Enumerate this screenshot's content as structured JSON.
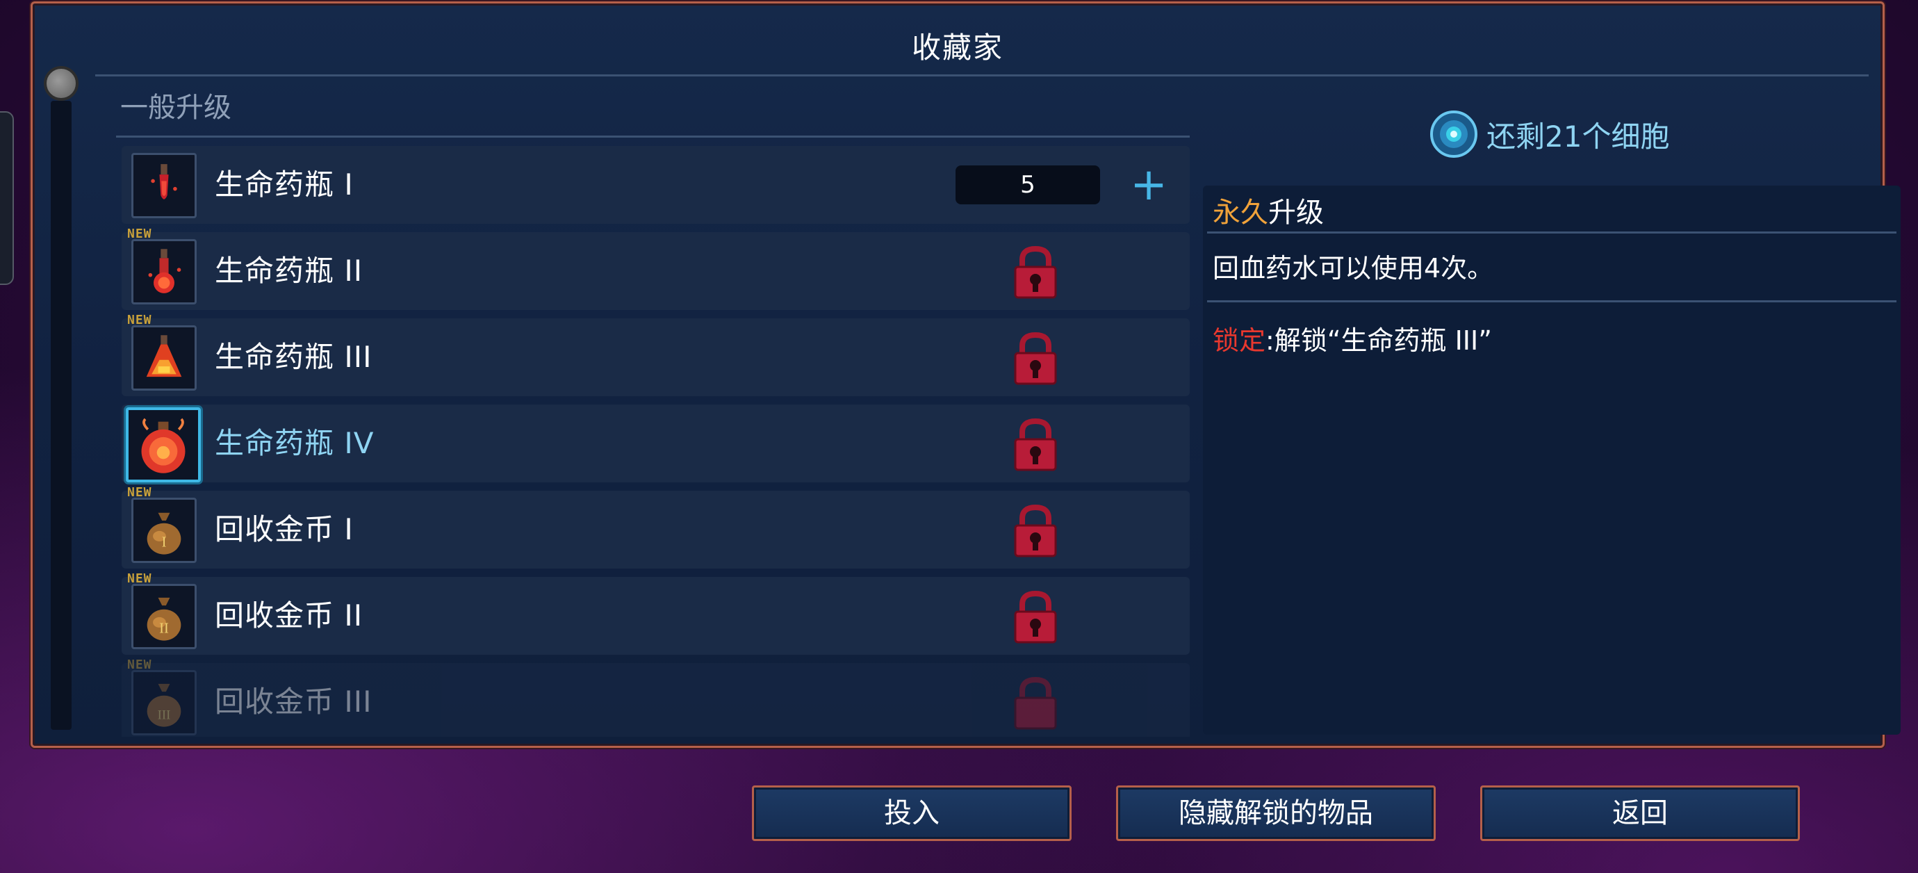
{
  "window": {
    "title": "收藏家"
  },
  "list": {
    "section_title": "一般升级",
    "items": [
      {
        "label": "生命药瓶 I",
        "count": "5",
        "state": "available",
        "new": false
      },
      {
        "label": "生命药瓶 II",
        "state": "locked",
        "new": true,
        "new_tag": "NEW"
      },
      {
        "label": "生命药瓶 III",
        "state": "locked",
        "new": true,
        "new_tag": "NEW"
      },
      {
        "label": "生命药瓶 IV",
        "state": "locked",
        "selected": true,
        "new": false
      },
      {
        "label": "回收金币 I",
        "state": "locked",
        "new": true,
        "new_tag": "NEW"
      },
      {
        "label": "回收金币 II",
        "state": "locked",
        "new": true,
        "new_tag": "NEW"
      },
      {
        "label": "回收金币 III",
        "state": "locked",
        "new": true,
        "new_tag": "NEW"
      }
    ],
    "plus_label": "+"
  },
  "cells": {
    "text": "还剩21个细胞"
  },
  "detail": {
    "type_accent": "永久",
    "type_rest": "升级",
    "description": "回血药水可以使用4次。",
    "lock_prefix": "锁定",
    "lock_text": ":解锁“生命药瓶 III”"
  },
  "buttons": {
    "invest": "投入",
    "hide_unlocked": "隐藏解锁的物品",
    "back": "返回"
  },
  "colors": {
    "accent_cyan": "#8fd4f2",
    "accent_orange": "#f0a23a",
    "lock_red": "#e8382e",
    "frame": "#b5604a"
  }
}
